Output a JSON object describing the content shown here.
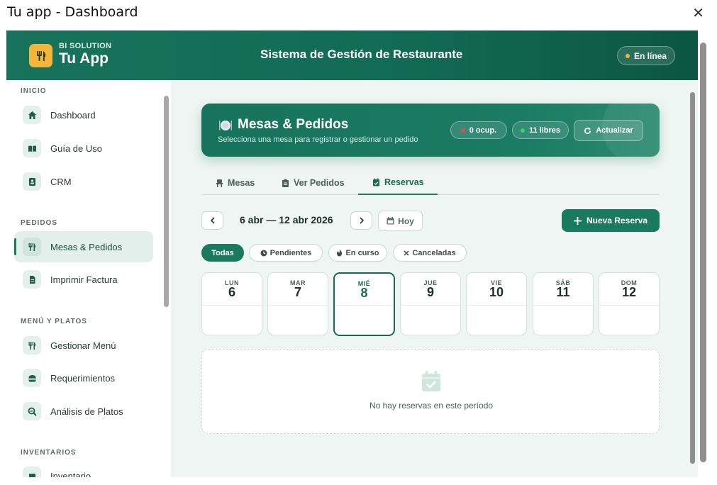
{
  "window": {
    "title": "Tu app - Dashboard",
    "close": "✕"
  },
  "header": {
    "brand_sub": "BI SOLUTION",
    "brand_name": "Tu App",
    "title": "Sistema de Gestión de Restaurante",
    "status": "En línea",
    "status_color": "#f4b63a"
  },
  "sidebar": {
    "sections": [
      {
        "label": "INICIO"
      },
      {
        "label": "PEDIDOS"
      },
      {
        "label": "MENÚ Y PLATOS"
      },
      {
        "label": "INVENTARIOS"
      }
    ],
    "items": [
      {
        "label": "Dashboard",
        "icon": "home-icon"
      },
      {
        "label": "Guía de Uso",
        "icon": "book-icon"
      },
      {
        "label": "CRM",
        "icon": "contacts-icon"
      },
      {
        "label": "Mesas & Pedidos",
        "icon": "utensils-icon",
        "active": true
      },
      {
        "label": "Imprimir Factura",
        "icon": "invoice-icon"
      },
      {
        "label": "Gestionar Menú",
        "icon": "utensils-icon"
      },
      {
        "label": "Requerimientos",
        "icon": "burger-icon"
      },
      {
        "label": "Análisis de Platos",
        "icon": "search-chart-icon"
      },
      {
        "label": "Inventario",
        "icon": "box-icon"
      }
    ]
  },
  "hero": {
    "emoji": "🍽️",
    "title": "Mesas & Pedidos",
    "subtitle": "Selecciona una mesa para registrar o gestionar un pedido",
    "occupied": "0 ocup.",
    "free": "11 libres",
    "refresh": "Actualizar"
  },
  "tabs": [
    {
      "label": "Mesas",
      "icon": "chair-icon"
    },
    {
      "label": "Ver Pedidos",
      "icon": "clipboard-icon"
    },
    {
      "label": "Reservas",
      "icon": "calendar-check-icon",
      "active": true
    }
  ],
  "calendar": {
    "range": "6 abr — 12 abr 2026",
    "today_label": "Hoy",
    "new_reservation": "Nueva Reserva",
    "filters": [
      {
        "label": "Todas",
        "active": true
      },
      {
        "label": "Pendientes",
        "icon": "clock-icon"
      },
      {
        "label": "En curso",
        "icon": "flame-icon"
      },
      {
        "label": "Canceladas",
        "icon": "x-icon"
      }
    ],
    "days": [
      {
        "name": "LUN",
        "num": "6"
      },
      {
        "name": "MAR",
        "num": "7"
      },
      {
        "name": "MIÉ",
        "num": "8",
        "today": true
      },
      {
        "name": "JUE",
        "num": "9"
      },
      {
        "name": "VIE",
        "num": "10"
      },
      {
        "name": "SÁB",
        "num": "11"
      },
      {
        "name": "DOM",
        "num": "12"
      }
    ],
    "empty_text": "No hay reservas en este período"
  },
  "colors": {
    "primary": "#1a7a5e",
    "accent": "#f4b63a",
    "occupied": "#e5484d",
    "free": "#3ccf6e"
  }
}
